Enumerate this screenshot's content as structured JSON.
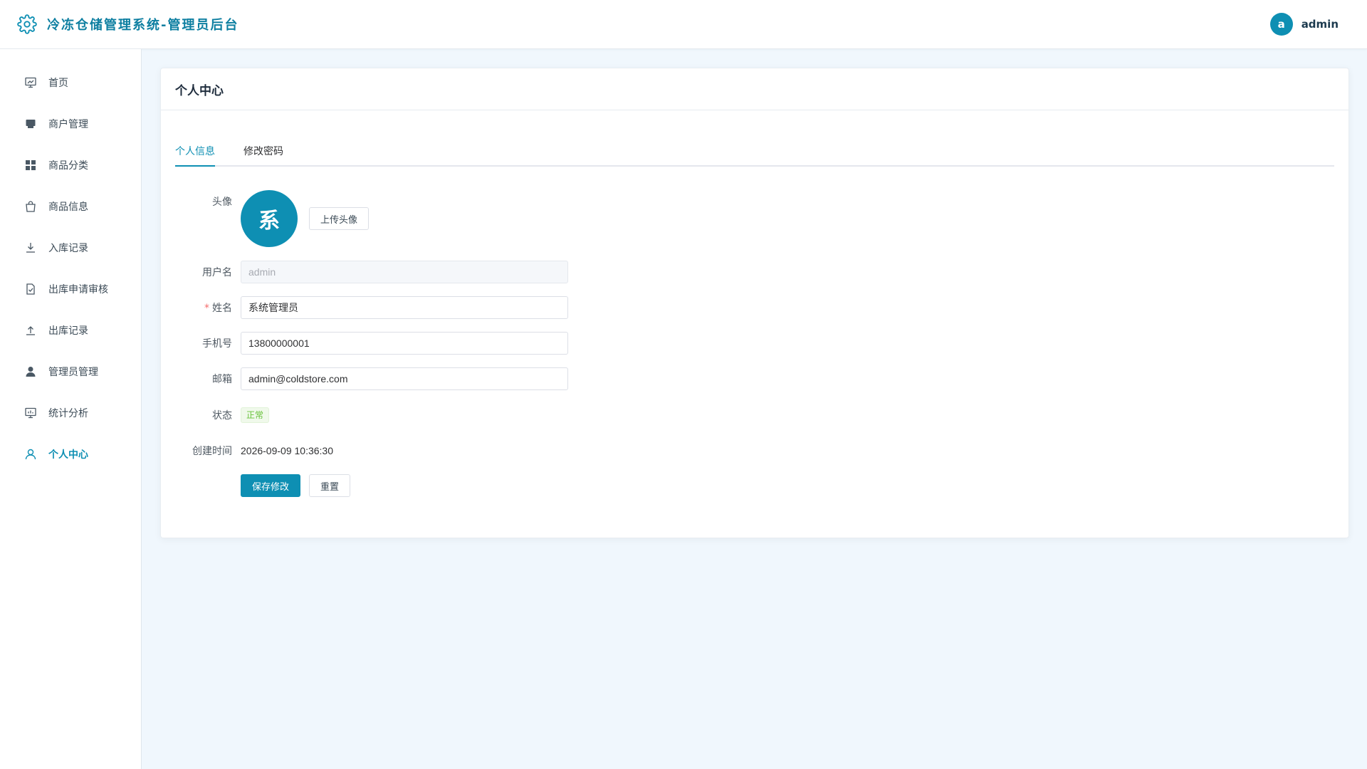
{
  "header": {
    "title": "冷冻仓储管理系统-管理员后台",
    "user_initial": "a",
    "user_name": "admin"
  },
  "colors": {
    "accent": "#0e8fb3",
    "brand_text": "#0e7fa1",
    "success": "#67c23a",
    "background": "#f0f7fd"
  },
  "sidebar": {
    "items": [
      {
        "label": "首页",
        "icon": "dashboard-icon"
      },
      {
        "label": "商户管理",
        "icon": "shop-icon"
      },
      {
        "label": "商品分类",
        "icon": "grid-icon"
      },
      {
        "label": "商品信息",
        "icon": "bag-icon"
      },
      {
        "label": "入库记录",
        "icon": "download-icon"
      },
      {
        "label": "出库申请审核",
        "icon": "document-check-icon"
      },
      {
        "label": "出库记录",
        "icon": "upload-icon"
      },
      {
        "label": "管理员管理",
        "icon": "user-filled-icon"
      },
      {
        "label": "统计分析",
        "icon": "chart-board-icon"
      },
      {
        "label": "个人中心",
        "icon": "user-icon",
        "active": true
      }
    ]
  },
  "main": {
    "card_title": "个人中心",
    "tabs": [
      {
        "label": "个人信息",
        "active": true
      },
      {
        "label": "修改密码",
        "active": false
      }
    ],
    "form": {
      "avatar_label": "头像",
      "avatar_char": "系",
      "upload_button": "上传头像",
      "username_label": "用户名",
      "username_value": "admin",
      "name_label": "姓名",
      "name_required_mark": "*",
      "name_value": "系统管理员",
      "phone_label": "手机号",
      "phone_value": "13800000001",
      "email_label": "邮箱",
      "email_value": "admin@coldstore.com",
      "status_label": "状态",
      "status_value": "正常",
      "created_label": "创建时间",
      "created_value": "2026-09-09 10:36:30",
      "save_button": "保存修改",
      "reset_button": "重置"
    }
  }
}
